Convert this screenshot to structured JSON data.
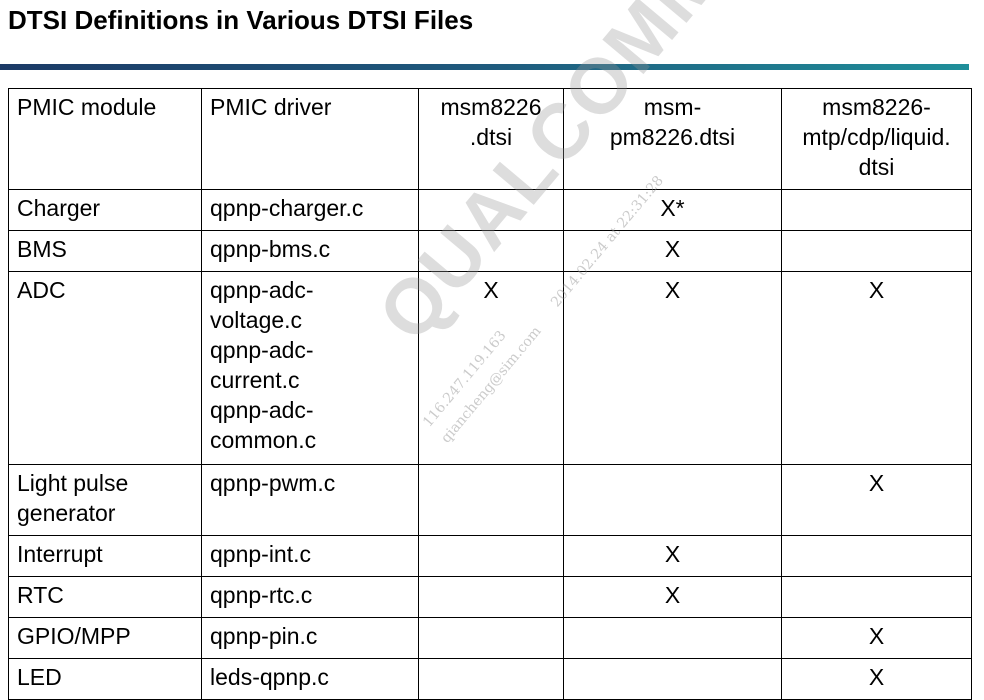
{
  "page": {
    "title": "DTSI Definitions in Various DTSI Files"
  },
  "watermark": {
    "brand": "QUALCOMM",
    "timestamp": "2014.02.24 at 22:31:28",
    "ip": "116.247.119.163",
    "user": "qiancheng@sim.com"
  },
  "table": {
    "headers": [
      [
        "PMIC module"
      ],
      [
        "PMIC driver"
      ],
      [
        "msm8226",
        ".dtsi"
      ],
      [
        "msm-",
        "pm8226.dtsi"
      ],
      [
        "msm8226-",
        "mtp/cdp/liquid.",
        "dtsi"
      ]
    ],
    "rows": [
      {
        "module": [
          "Charger"
        ],
        "driver": [
          "qpnp-charger.c"
        ],
        "msm8226": "",
        "pm8226": "X*",
        "mtp": ""
      },
      {
        "module": [
          "BMS"
        ],
        "driver": [
          "qpnp-bms.c"
        ],
        "msm8226": "",
        "pm8226": "X",
        "mtp": ""
      },
      {
        "module": [
          "ADC"
        ],
        "driver": [
          "qpnp-adc-",
          "voltage.c",
          "qpnp-adc-",
          "current.c",
          "qpnp-adc-",
          "common.c"
        ],
        "msm8226": "X",
        "pm8226": "X",
        "mtp": "X"
      },
      {
        "module": [
          "Light pulse",
          "generator"
        ],
        "driver": [
          "qpnp-pwm.c"
        ],
        "msm8226": "",
        "pm8226": "",
        "mtp": "X"
      },
      {
        "module": [
          "Interrupt"
        ],
        "driver": [
          "qpnp-int.c"
        ],
        "msm8226": "",
        "pm8226": "X",
        "mtp": ""
      },
      {
        "module": [
          "RTC"
        ],
        "driver": [
          "qpnp-rtc.c"
        ],
        "msm8226": "",
        "pm8226": "X",
        "mtp": ""
      },
      {
        "module": [
          "GPIO/MPP"
        ],
        "driver": [
          "qpnp-pin.c"
        ],
        "msm8226": "",
        "pm8226": "",
        "mtp": "X"
      },
      {
        "module": [
          "LED"
        ],
        "driver": [
          "leds-qpnp.c"
        ],
        "msm8226": "",
        "pm8226": "",
        "mtp": "X"
      }
    ]
  }
}
